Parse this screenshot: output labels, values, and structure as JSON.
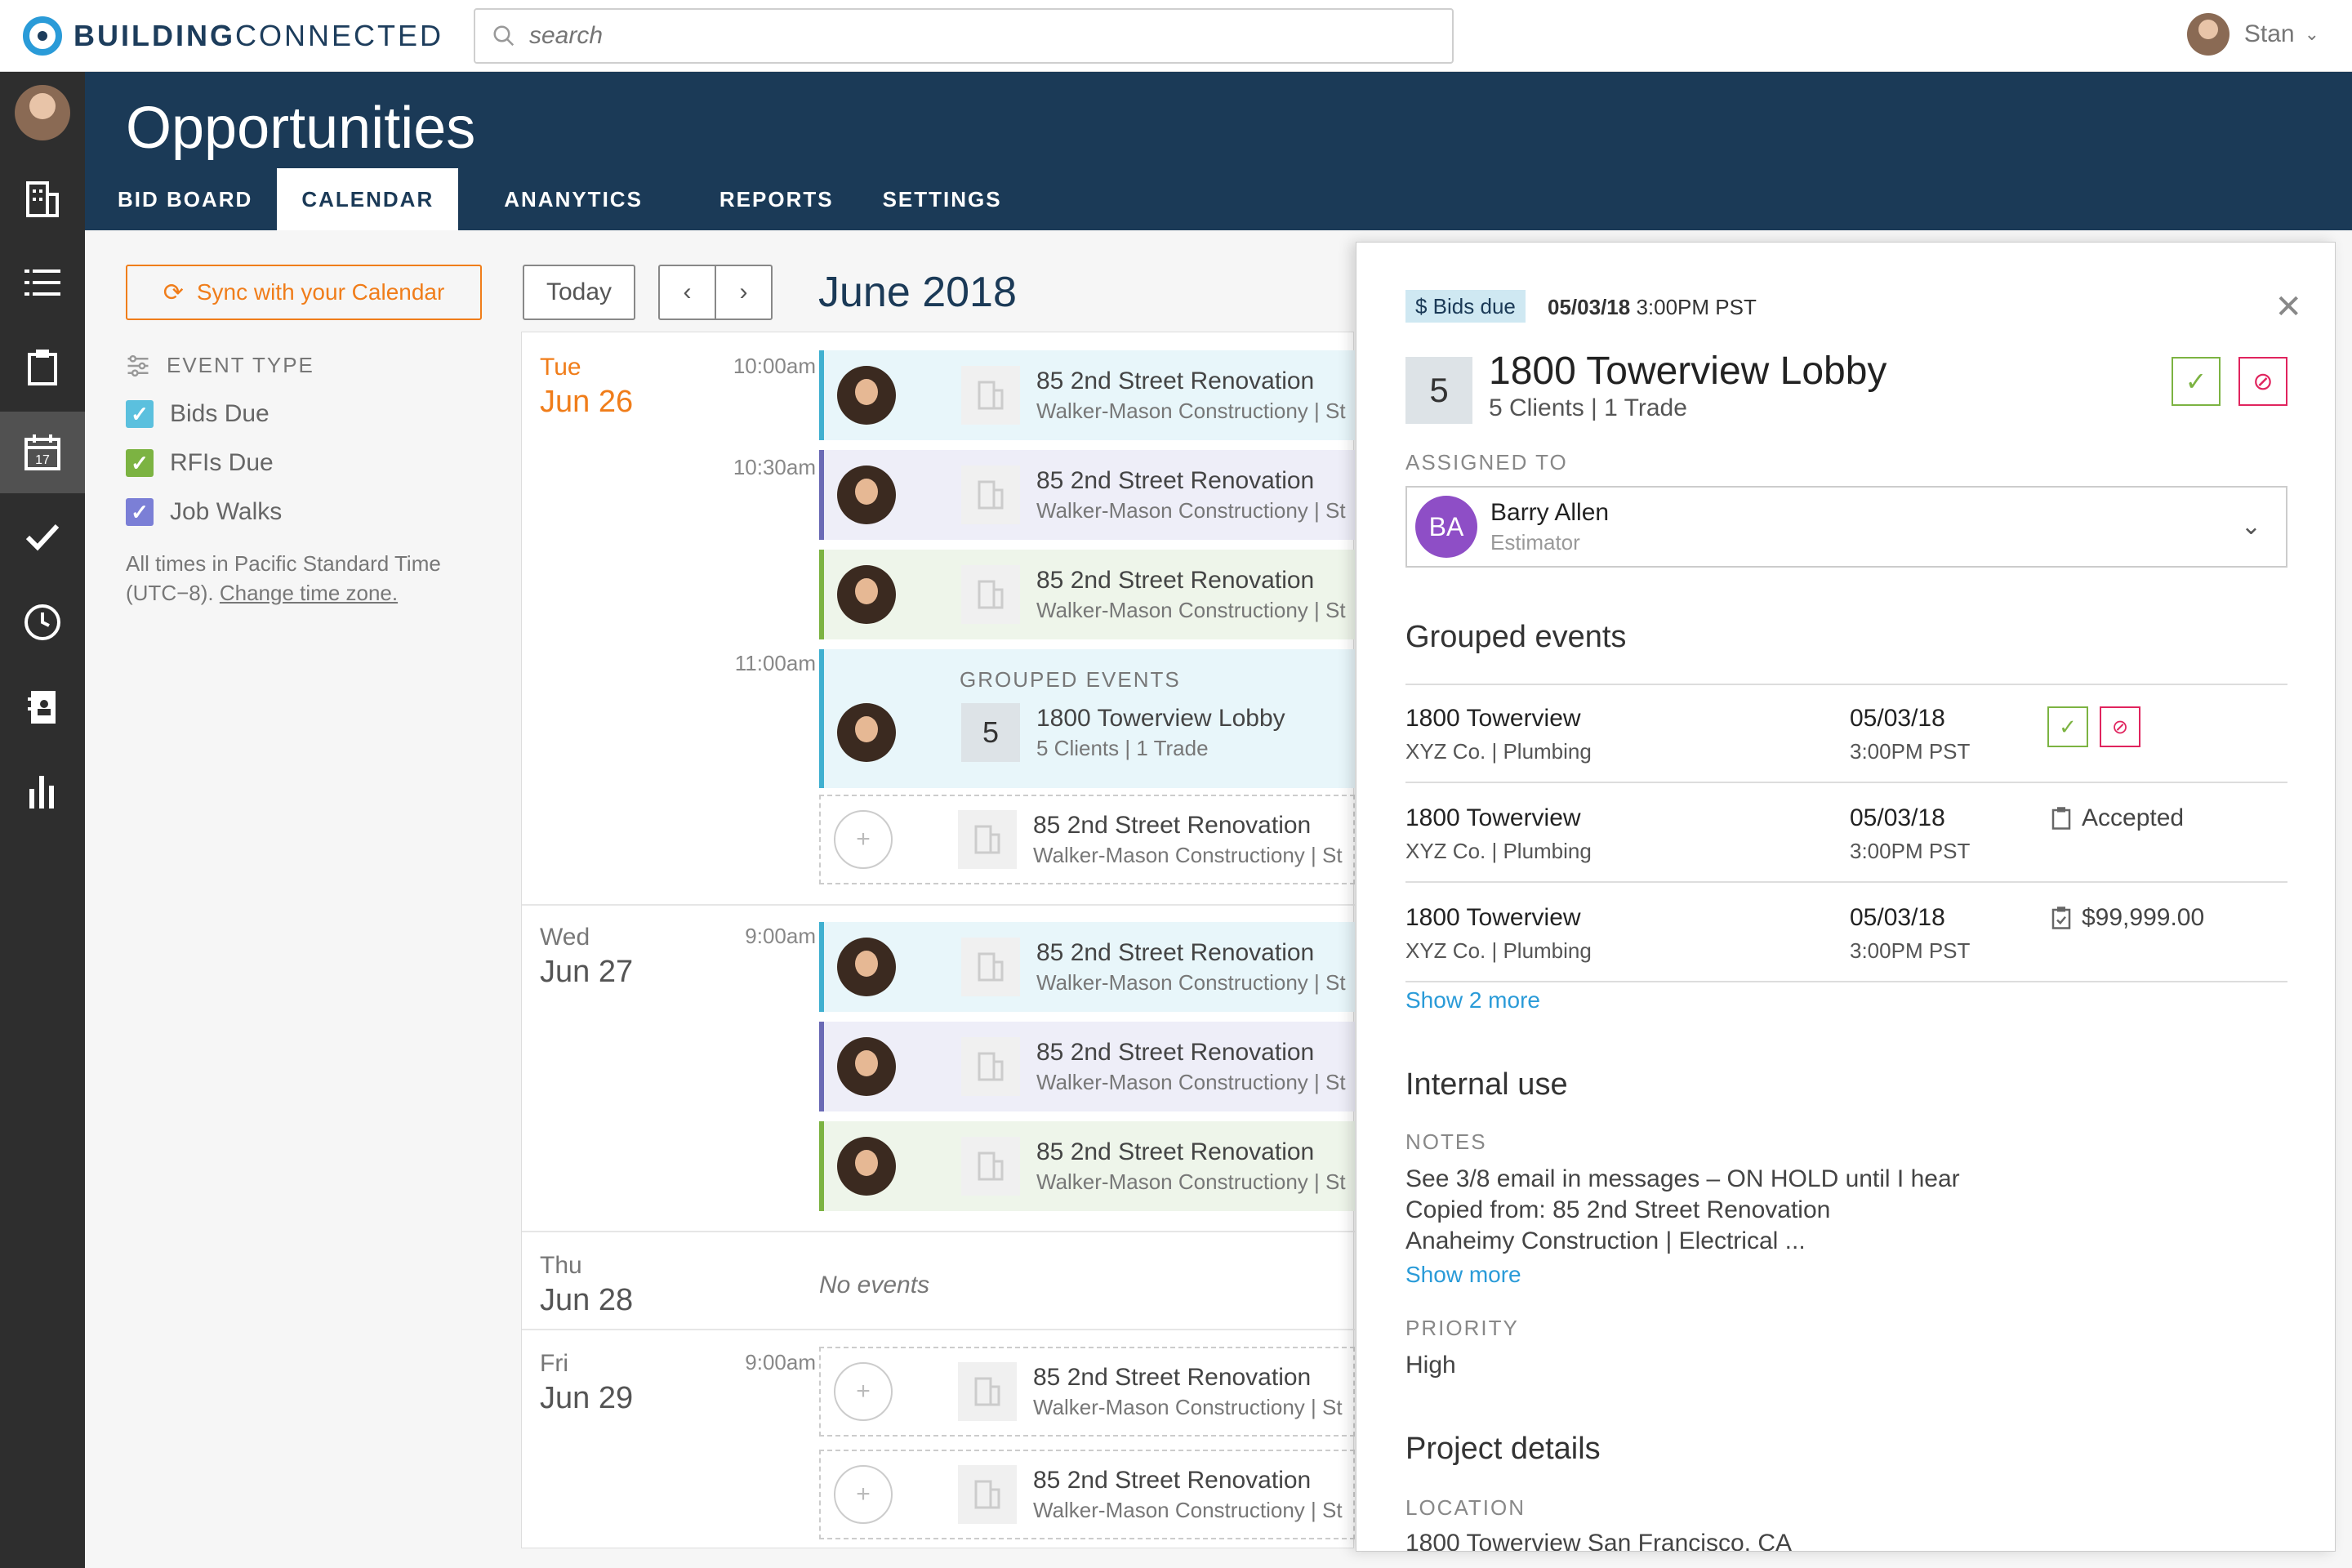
{
  "app": {
    "logo_bold": "BUILDING",
    "logo_light": "CONNECTED",
    "search_placeholder": "search",
    "user_name": "Stan"
  },
  "header": {
    "title": "Opportunities",
    "tabs": [
      "BID BOARD",
      "CALENDAR",
      "ANANYTICS",
      "REPORTS",
      "SETTINGS"
    ],
    "active_tab": "CALENDAR"
  },
  "left": {
    "sync_label": "Sync with your Calendar",
    "event_type_label": "EVENT TYPE",
    "filters": [
      {
        "label": "Bids Due",
        "color": "#5bc0de"
      },
      {
        "label": "RFIs Due",
        "color": "#7cb342"
      },
      {
        "label": "Job Walks",
        "color": "#7b7fd6"
      }
    ],
    "tz_text": "All times in Pacific Standard Time (UTC−8).",
    "tz_link": "Change time zone."
  },
  "calendar": {
    "today_label": "Today",
    "month": "June 2018",
    "days": [
      {
        "dow": "Tue",
        "date": "Jun 26"
      },
      {
        "dow": "Wed",
        "date": "Jun 27"
      },
      {
        "dow": "Thu",
        "date": "Jun 28"
      },
      {
        "dow": "Fri",
        "date": "Jun 29"
      }
    ],
    "times": [
      "10:00am",
      "10:30am",
      "11:00am",
      "9:00am",
      "9:00am"
    ],
    "event_title": "85 2nd Street Renovation",
    "event_sub": "Walker-Mason Constructiony | St",
    "grouped_label": "GROUPED EVENTS",
    "grouped_count": "5",
    "grouped_title": "1800 Towerview Lobby",
    "grouped_sub": "5 Clients | 1 Trade",
    "no_events": "No events"
  },
  "drawer": {
    "badge": "$ Bids due",
    "due_date": "05/03/18",
    "due_time": "3:00PM PST",
    "count": "5",
    "title": "1800 Towerview Lobby",
    "subtitle": "5 Clients  |  1 Trade",
    "assigned_label": "ASSIGNED TO",
    "assignee_initials": "BA",
    "assignee_name": "Barry Allen",
    "assignee_role": "Estimator",
    "grouped_heading": "Grouped events",
    "rows": [
      {
        "title": "1800 Towerview",
        "sub": "XYZ Co.  |  Plumbing",
        "date": "05/03/18",
        "time": "3:00PM PST",
        "status": ""
      },
      {
        "title": "1800 Towerview",
        "sub": "XYZ Co.  |  Plumbing",
        "date": "05/03/18",
        "time": "3:00PM PST",
        "status": "Accepted"
      },
      {
        "title": "1800 Towerview",
        "sub": "XYZ Co.  |  Plumbing",
        "date": "05/03/18",
        "time": "3:00PM PST",
        "status": "$99,999.00"
      }
    ],
    "show_more_rows": "Show 2 more",
    "internal_heading": "Internal use",
    "notes_label": "NOTES",
    "notes_lines": [
      "See 3/8 email in messages – ON HOLD until I hear",
      "Copied from: 85 2nd Street Renovation",
      "Anaheimy Construction  |  Electrical ..."
    ],
    "show_more": "Show more",
    "priority_label": "PRIORITY",
    "priority": "High",
    "project_heading": "Project details",
    "location_label": "LOCATION",
    "location": "1800 Towerview San Francisco, CA"
  }
}
